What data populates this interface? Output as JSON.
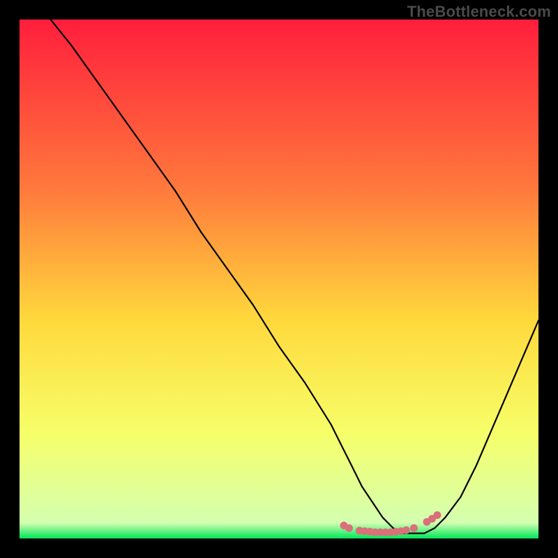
{
  "watermark": "TheBottleneck.com",
  "chart_data": {
    "type": "line",
    "title": "",
    "xlabel": "",
    "ylabel": "",
    "xlim": [
      0,
      100
    ],
    "ylim": [
      0,
      100
    ],
    "grid": false,
    "legend": false,
    "series": [
      {
        "name": "curve",
        "x": [
          6,
          10,
          15,
          20,
          25,
          30,
          35,
          40,
          45,
          50,
          55,
          60,
          62,
          64,
          66,
          68,
          70,
          72,
          74,
          76,
          78,
          80,
          82,
          85,
          88,
          91,
          94,
          97,
          100
        ],
        "y": [
          100,
          95,
          88,
          81,
          74,
          67,
          59,
          52,
          45,
          37,
          30,
          22,
          18,
          14,
          10,
          7,
          4,
          2,
          1,
          1,
          1,
          2,
          4,
          8,
          14,
          21,
          28,
          35,
          42
        ]
      },
      {
        "name": "markers",
        "type": "scatter",
        "x": [
          62.5,
          63.5,
          65.5,
          66.5,
          67.5,
          68.5,
          69.5,
          70.5,
          71.5,
          72.5,
          73.5,
          74.5,
          76.0,
          78.5,
          79.5,
          80.5
        ],
        "y": [
          2.5,
          2.0,
          1.5,
          1.4,
          1.3,
          1.2,
          1.2,
          1.2,
          1.2,
          1.3,
          1.4,
          1.6,
          2.0,
          3.2,
          3.8,
          4.5
        ]
      }
    ],
    "colors": {
      "gradient_top": "#ff1e3c",
      "gradient_mid1": "#ff7a3c",
      "gradient_mid2": "#ffd93c",
      "gradient_mid3": "#f6ff6a",
      "gradient_bottom": "#00e65a",
      "curve": "#000000",
      "marker": "#d9707a"
    }
  }
}
